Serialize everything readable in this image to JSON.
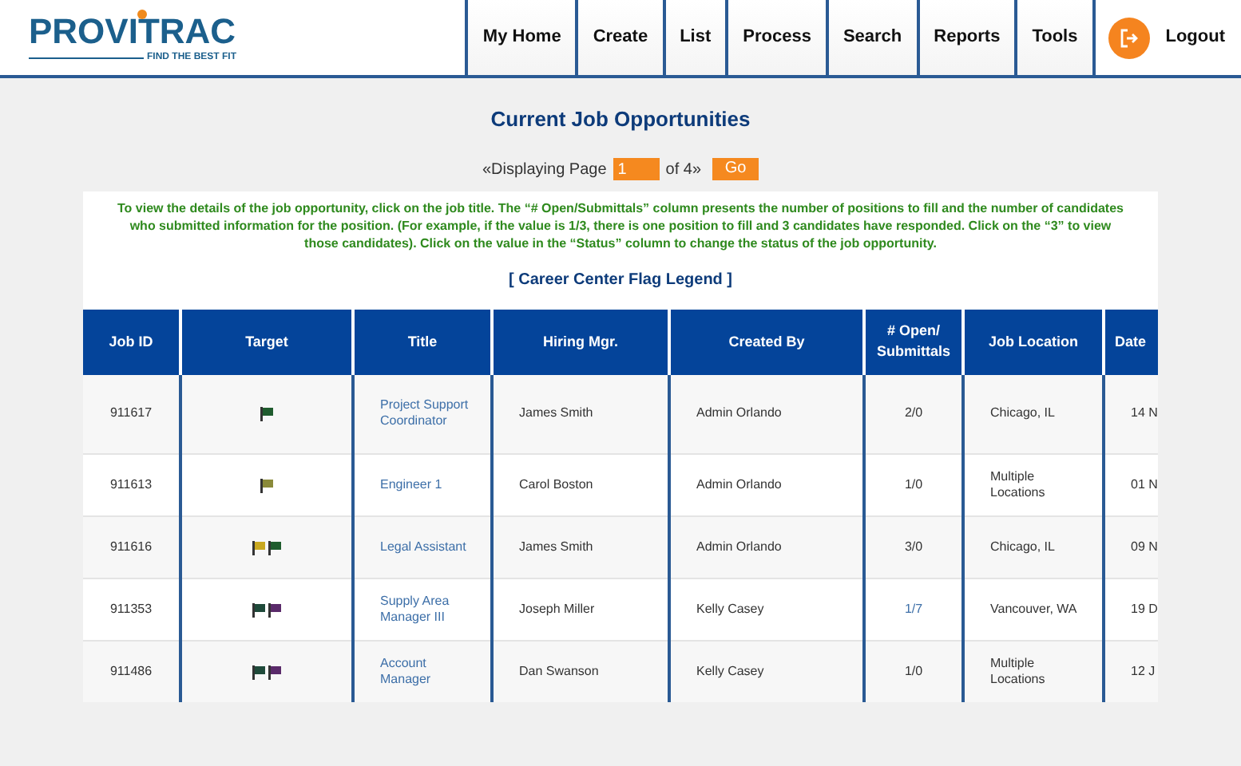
{
  "logo": {
    "name": "PROVITRAC",
    "tagline": "FIND THE BEST FIT"
  },
  "nav": [
    {
      "label": "My Home"
    },
    {
      "label": "Create"
    },
    {
      "label": "List"
    },
    {
      "label": "Process"
    },
    {
      "label": "Search"
    },
    {
      "label": "Reports"
    },
    {
      "label": "Tools"
    }
  ],
  "logout": {
    "label": "Logout"
  },
  "title": "Current Job Opportunities",
  "pager": {
    "prefix": "«Displaying Page",
    "page": "1",
    "suffix": "of 4»",
    "go": "Go"
  },
  "instructions": "To view the details of the job opportunity, click on the job title. The “# Open/Submittals” column presents the number of positions to fill and the number of candidates who submitted information for the position. (For example, if the value is 1/3, there is one position to fill and 3 candidates have responded. Click on the “3” to view those candidates). Click on the value in the “Status” column to change the status of the job opportunity.",
  "legend_link": "[ Career Center Flag Legend ]",
  "table": {
    "columns": [
      "Job ID",
      "Target",
      "Title",
      "Hiring Mgr.",
      "Created By",
      "# Open/ Submittals",
      "Job Location",
      "Date"
    ],
    "rows": [
      {
        "job_id": "911617",
        "flags": [
          {
            "color": "#1f5c2e"
          }
        ],
        "title": "Project Support Coordinator",
        "hiring_mgr": "James Smith",
        "created_by": "Admin Orlando",
        "open": {
          "text": "2/0",
          "linked": false
        },
        "location": "Chicago, IL",
        "date": "14 N"
      },
      {
        "job_id": "911613",
        "flags": [
          {
            "color": "#8a8a3a"
          }
        ],
        "title": "Engineer 1",
        "hiring_mgr": "Carol Boston",
        "created_by": "Admin Orlando",
        "open": {
          "text": "1/0",
          "linked": false
        },
        "location": "Multiple Locations",
        "date": "01 N"
      },
      {
        "job_id": "911616",
        "flags": [
          {
            "color": "#c9a820"
          },
          {
            "color": "#1f5c2e"
          }
        ],
        "title": "Legal Assistant",
        "hiring_mgr": "James Smith",
        "created_by": "Admin Orlando",
        "open": {
          "text": "3/0",
          "linked": false
        },
        "location": "Chicago, IL",
        "date": "09 N"
      },
      {
        "job_id": "911353",
        "flags": [
          {
            "color": "#1f4a3a"
          },
          {
            "color": "#5a2a6a"
          }
        ],
        "title": "Supply Area Manager III",
        "hiring_mgr": "Joseph Miller",
        "created_by": "Kelly Casey",
        "open": {
          "text": "1/7",
          "linked": true
        },
        "location": "Vancouver, WA",
        "date": "19 D"
      },
      {
        "job_id": "911486",
        "flags": [
          {
            "color": "#1f4a3a"
          },
          {
            "color": "#5a2a6a"
          }
        ],
        "title": "Account Manager",
        "hiring_mgr": "Dan Swanson",
        "created_by": "Kelly Casey",
        "open": {
          "text": "1/0",
          "linked": false
        },
        "location": "Multiple Locations",
        "date": "12 J"
      }
    ]
  }
}
